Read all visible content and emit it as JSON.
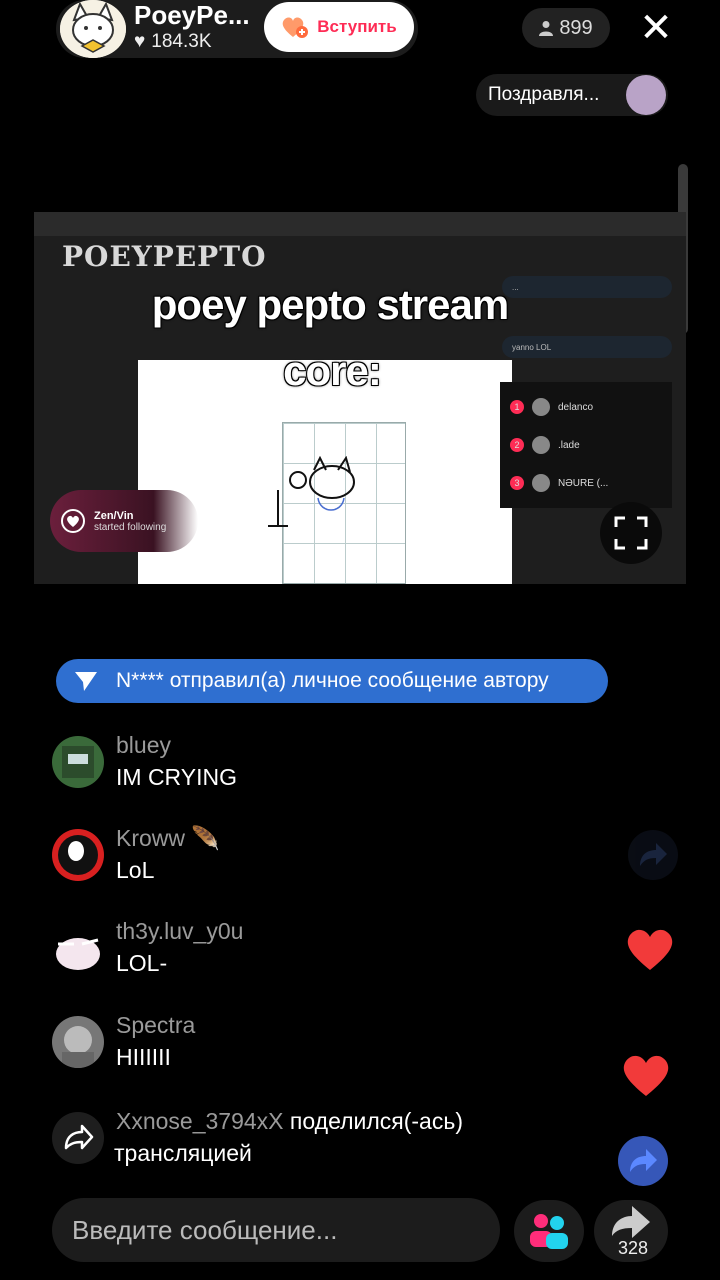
{
  "header": {
    "host_name": "PoeyPe...",
    "likes": "184.3K",
    "join_label": "Вступить",
    "viewer_count": "899",
    "congrats_label": "Поздравля..."
  },
  "stream": {
    "logo_text": "POEYPEPTO",
    "caption_line1": "poey pepto stream",
    "caption_line2": "core:",
    "follow_toast_name": "Zen/Vin",
    "follow_toast_text": "started following",
    "mini_chat": [
      "...",
      "yanno LOL"
    ],
    "ranking": [
      {
        "rank": "1",
        "name": "delanco"
      },
      {
        "rank": "2",
        "name": ".lade"
      },
      {
        "rank": "3",
        "name": "NƏURE (..."
      }
    ]
  },
  "notice": {
    "text": "N**** отправил(а) личное сообщение автору"
  },
  "comments": [
    {
      "user": "bluey",
      "text": "IM CRYING"
    },
    {
      "user": "Kroww",
      "text": "LoL"
    },
    {
      "user": "th3y.luv_y0u",
      "text": "LOL-"
    },
    {
      "user": "Spectra",
      "text": "HIIIIII"
    }
  ],
  "share_event": {
    "user": "Xxnose_3794xX",
    "action": "поделился(-ась)",
    "object": "трансляцией"
  },
  "bottom": {
    "input_placeholder": "Введите сообщение...",
    "share_count": "328"
  },
  "colors": {
    "accent": "#fe2c55",
    "notice_blue": "#2f6fd0"
  }
}
